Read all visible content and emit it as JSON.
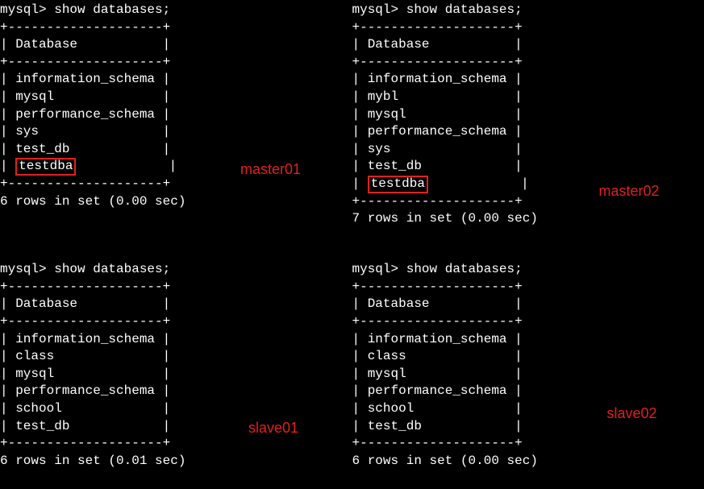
{
  "panels": {
    "master01": {
      "prompt": "mysql> show databases;",
      "border_top": "+--------------------+",
      "header_row": "| Database           |",
      "border_mid": "+--------------------+",
      "rows": [
        "| information_schema |",
        "| mysql              |",
        "| performance_schema |",
        "| sys                |",
        "| test_db            |"
      ],
      "highlight_pre": "| ",
      "highlight_text": "testdba",
      "highlight_post": "            |",
      "border_bot": "+--------------------+",
      "footer": "6 rows in set (0.00 sec)",
      "label": "master01"
    },
    "master02": {
      "prompt": "mysql> show databases;",
      "border_top": "+--------------------+",
      "header_row": "| Database           |",
      "border_mid": "+--------------------+",
      "rows": [
        "| information_schema |",
        "| mybl               |",
        "| mysql              |",
        "| performance_schema |",
        "| sys                |",
        "| test_db            |"
      ],
      "highlight_pre": "| ",
      "highlight_text": "testdba",
      "highlight_post": "            |",
      "border_bot": "+--------------------+",
      "footer": "7 rows in set (0.00 sec)",
      "label": "master02"
    },
    "slave01": {
      "prompt": "mysql> show databases;",
      "border_top": "+--------------------+",
      "header_row": "| Database           |",
      "border_mid": "+--------------------+",
      "rows": [
        "| information_schema |",
        "| class              |",
        "| mysql              |",
        "| performance_schema |",
        "| school             |",
        "| test_db            |"
      ],
      "border_bot": "+--------------------+",
      "footer": "6 rows in set (0.01 sec)",
      "label": "slave01"
    },
    "slave02": {
      "prompt": "mysql> show databases;",
      "border_top": "+--------------------+",
      "header_row": "| Database           |",
      "border_mid": "+--------------------+",
      "rows": [
        "| information_schema |",
        "| class              |",
        "| mysql              |",
        "| performance_schema |",
        "| school             |",
        "| test_db            |"
      ],
      "border_bot": "+--------------------+",
      "footer": "6 rows in set (0.00 sec)",
      "label": "slave02"
    }
  }
}
